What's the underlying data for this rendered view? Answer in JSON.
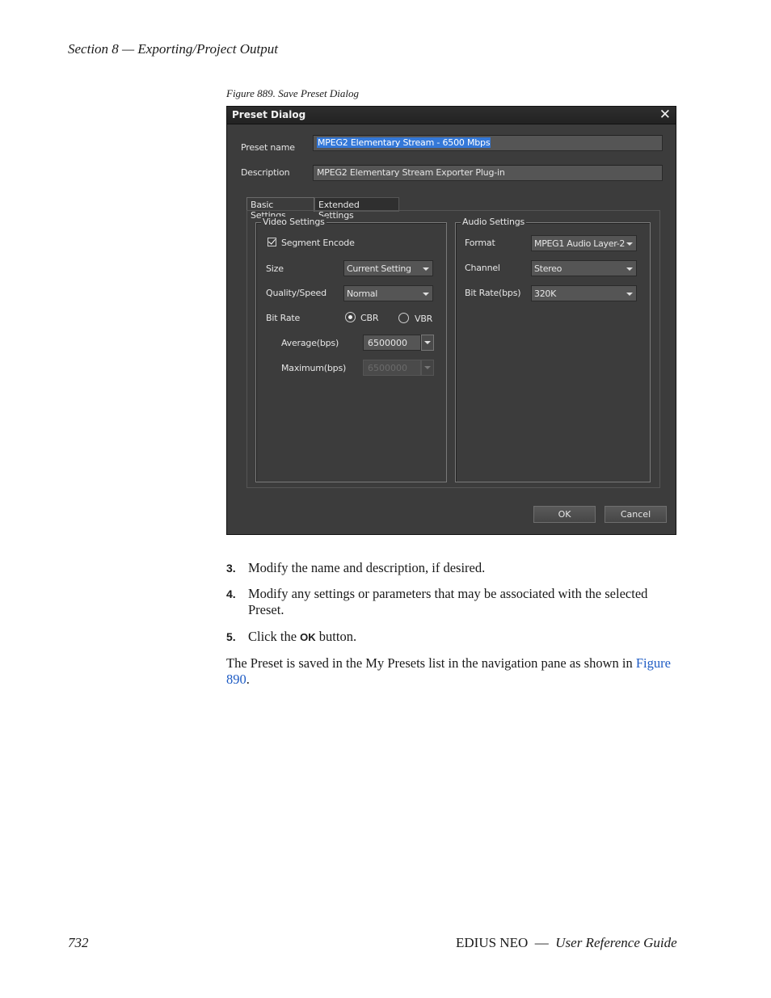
{
  "header": {
    "section": "Section 8 — Exporting/Project Output"
  },
  "figure": {
    "caption": "Figure 889.  Save Preset Dialog"
  },
  "dialog": {
    "title": "Preset Dialog",
    "close_glyph": "✕",
    "preset_name_label": "Preset name",
    "preset_name_value": "MPEG2 Elementary Stream - 6500 Mbps",
    "description_label": "Description",
    "description_value": "MPEG2 Elementary Stream Exporter Plug-in",
    "tabs": [
      {
        "label": "Basic Settings",
        "active": true
      },
      {
        "label": "Extended Settings",
        "active": false
      }
    ],
    "video": {
      "legend": "Video Settings",
      "segment_encode_label": "Segment Encode",
      "segment_encode_checked": true,
      "size_label": "Size",
      "size_value": "Current Setting",
      "quality_label": "Quality/Speed",
      "quality_value": "Normal",
      "bitrate_label": "Bit Rate",
      "cbr_label": "CBR",
      "vbr_label": "VBR",
      "selected_mode": "CBR",
      "average_label": "Average(bps)",
      "average_value": "6500000",
      "maximum_label": "Maximum(bps)",
      "maximum_value": "6500000"
    },
    "audio": {
      "legend": "Audio Settings",
      "format_label": "Format",
      "format_value": "MPEG1 Audio Layer-2",
      "channel_label": "Channel",
      "channel_value": "Stereo",
      "bitrate_label": "Bit Rate(bps)",
      "bitrate_value": "320K"
    },
    "ok_label": "OK",
    "cancel_label": "Cancel"
  },
  "steps": [
    {
      "num": "3.",
      "text": "Modify the name and description, if desired."
    },
    {
      "num": "4.",
      "text": "Modify any settings or parameters that may be associated with the selected Preset."
    },
    {
      "num": "5.",
      "pre": "Click the ",
      "bold": "OK",
      "post": " button."
    }
  ],
  "paragraph": {
    "text": "The Preset is saved in the My Presets list in the navigation pane as shown in ",
    "link": "Figure 890",
    "end": "."
  },
  "footer": {
    "page": "732",
    "product": "EDIUS NEO",
    "dash": "—",
    "guide": "User Reference Guide"
  }
}
